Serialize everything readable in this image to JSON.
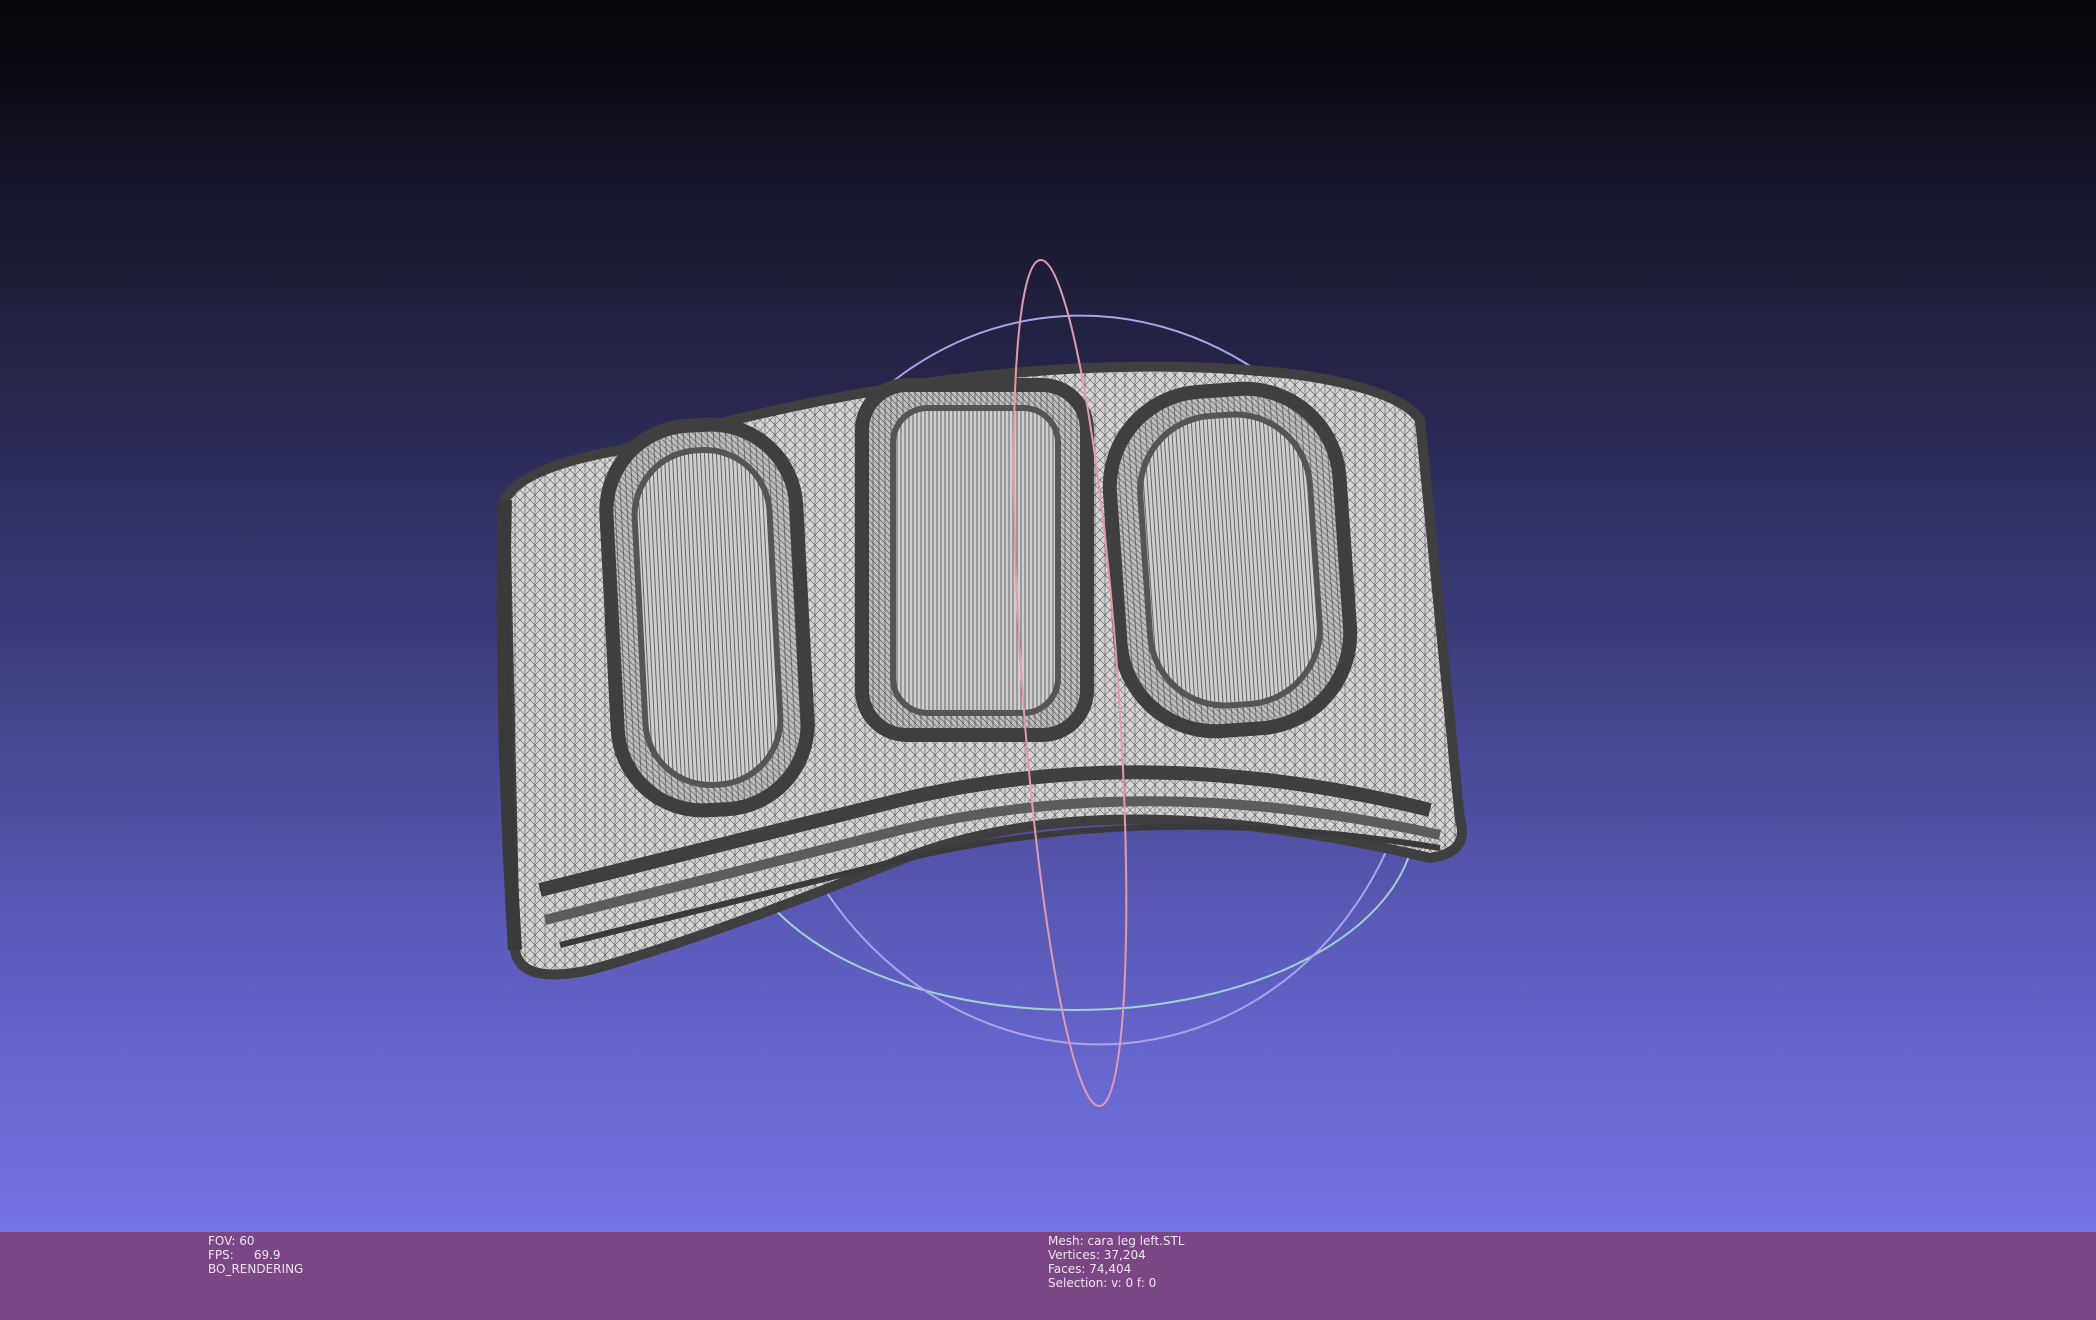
{
  "window": {
    "title": ""
  },
  "colors": {
    "statusbar": "#7c4585",
    "background_top": "#050508",
    "background_bottom": "#7474e8",
    "mesh_wire": "#3f3f3f",
    "mesh_fill": "#d7d7d7",
    "trackball_x": "#e39aa8",
    "trackball_y": "#9fd3d2",
    "trackball_z": "#a9a3e9"
  },
  "render_info": {
    "fov_label": "FOV:",
    "fov_value": "60",
    "fps_label": "FPS:",
    "fps_value": "69.9",
    "mode": "BO_RENDERING"
  },
  "mesh_info": {
    "mesh_label": "Mesh:",
    "mesh_name": "cara leg left.STL",
    "vertices_label": "Vertices:",
    "vertices_value": "37,204",
    "faces_label": "Faces:",
    "faces_value": "74,404",
    "selection_label": "Selection:",
    "selection_value": "v: 0 f: 0"
  },
  "viewport": {
    "object": "cara leg left.STL",
    "icons": [
      "trackball-icon",
      "mesh-wireframe-icon"
    ]
  }
}
